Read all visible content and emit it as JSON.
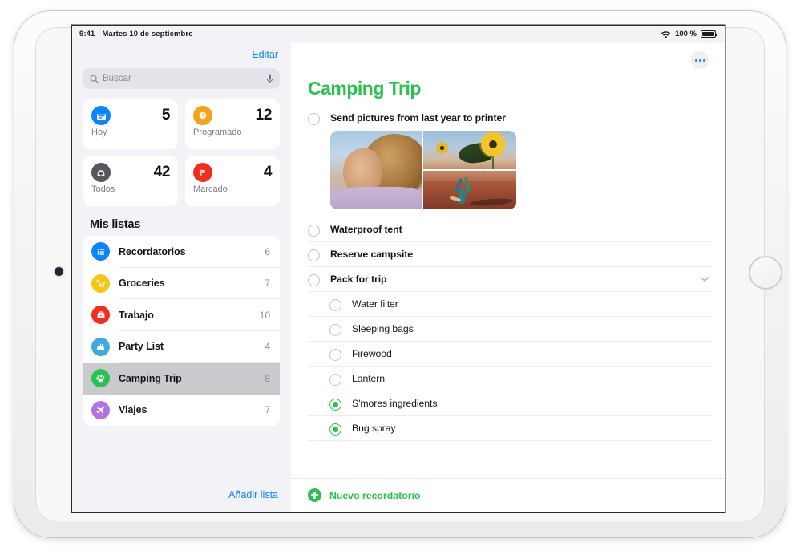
{
  "status_bar": {
    "time": "9:41",
    "date": "Martes 10 de septiembre",
    "battery_percent": "100 %",
    "wifi_icon": "wifi-icon",
    "battery_icon": "battery-full-icon"
  },
  "sidebar": {
    "edit_label": "Editar",
    "search": {
      "placeholder": "Buscar",
      "value": "",
      "search_icon": "search-icon",
      "mic_icon": "microphone-icon"
    },
    "smart_lists": [
      {
        "label": "Hoy",
        "count": "5",
        "icon": "calendar-today-icon",
        "color": "#0a84ff"
      },
      {
        "label": "Programado",
        "count": "12",
        "icon": "clock-icon",
        "color": "#f5a318"
      },
      {
        "label": "Todos",
        "count": "42",
        "icon": "inbox-tray-icon",
        "color": "#56565c"
      },
      {
        "label": "Marcado",
        "count": "4",
        "icon": "flag-icon",
        "color": "#f02f21"
      }
    ],
    "my_lists_header": "Mis listas",
    "lists": [
      {
        "label": "Recordatorios",
        "count": "6",
        "icon": "bulleted-list-icon",
        "color": "#0a84ff",
        "selected": false
      },
      {
        "label": "Groceries",
        "count": "7",
        "icon": "shopping-cart-icon",
        "color": "#f5c518",
        "selected": false
      },
      {
        "label": "Trabajo",
        "count": "10",
        "icon": "briefcase-icon",
        "color": "#f02f21",
        "selected": false
      },
      {
        "label": "Party List",
        "count": "4",
        "icon": "birthday-cake-icon",
        "color": "#3eaae0",
        "selected": false
      },
      {
        "label": "Camping Trip",
        "count": "8",
        "icon": "paw-print-icon",
        "color": "#2ac24f",
        "selected": true
      },
      {
        "label": "Viajes",
        "count": "7",
        "icon": "airplane-icon",
        "color": "#b273e0",
        "selected": false
      }
    ],
    "add_list_label": "Añadir lista"
  },
  "main": {
    "more_icon": "ellipsis-icon",
    "title": "Camping Trip",
    "title_color": "#2ac24f",
    "reminders": [
      {
        "text": "Send pictures from last year to printer",
        "done": false,
        "sub": false,
        "has_attachment": true,
        "has_disclosure": false
      },
      {
        "text": "Waterproof tent",
        "done": false,
        "sub": false,
        "has_attachment": false,
        "has_disclosure": false
      },
      {
        "text": "Reserve campsite",
        "done": false,
        "sub": false,
        "has_attachment": false,
        "has_disclosure": false
      },
      {
        "text": "Pack for trip",
        "done": false,
        "sub": false,
        "has_attachment": false,
        "has_disclosure": true
      },
      {
        "text": "Water filter",
        "done": false,
        "sub": true,
        "has_attachment": false,
        "has_disclosure": false
      },
      {
        "text": "Sleeping bags",
        "done": false,
        "sub": true,
        "has_attachment": false,
        "has_disclosure": false
      },
      {
        "text": "Firewood",
        "done": false,
        "sub": true,
        "has_attachment": false,
        "has_disclosure": false
      },
      {
        "text": "Lantern",
        "done": false,
        "sub": true,
        "has_attachment": false,
        "has_disclosure": false
      },
      {
        "text": "S'mores ingredients",
        "done": true,
        "sub": true,
        "has_attachment": false,
        "has_disclosure": false
      },
      {
        "text": "Bug spray",
        "done": true,
        "sub": true,
        "has_attachment": false,
        "has_disclosure": false
      }
    ],
    "attachment": {
      "photos": [
        "portrait-woman-photo",
        "sunflowers-sky-photo",
        "cartwheel-desert-photo"
      ]
    },
    "new_reminder_label": "Nuevo recordatorio",
    "plus_icon": "plus-circle-icon"
  }
}
